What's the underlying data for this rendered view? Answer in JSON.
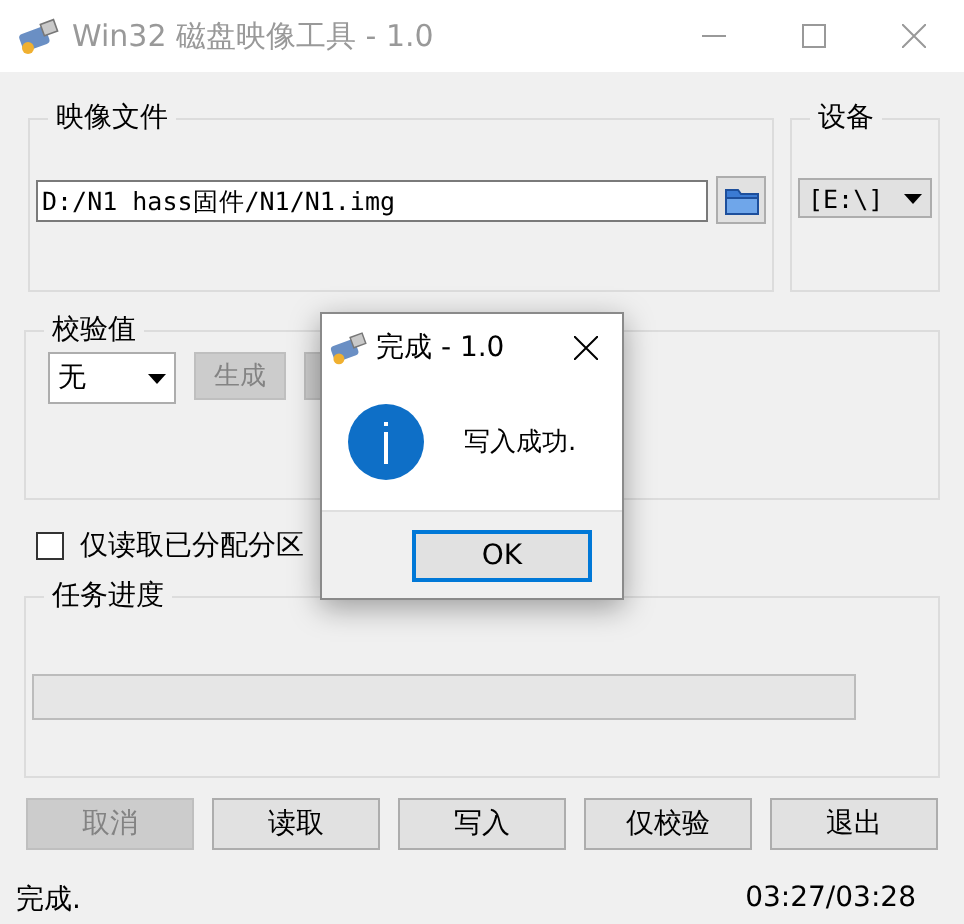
{
  "window": {
    "title": "Win32 磁盘映像工具 - 1.0"
  },
  "image_file": {
    "label": "映像文件",
    "path": "D:/N1 hass固件/N1/N1.img"
  },
  "device": {
    "label": "设备",
    "value": "[E:\\]"
  },
  "hash": {
    "label": "校验值",
    "type_value": "无",
    "buttons": [
      {
        "label": "生成",
        "disabled": true
      },
      {
        "disabled": true
      }
    ]
  },
  "read_only_allocated": {
    "label": "仅读取已分配分区",
    "checked": false
  },
  "progress": {
    "label": "任务进度",
    "level": 0
  },
  "buttons": [
    {
      "label": "取消",
      "disabled": true
    },
    {
      "label": "读取",
      "disabled": false
    },
    {
      "label": "写入",
      "disabled": false
    },
    {
      "label": "仅校验",
      "disabled": false
    },
    {
      "label": "退出",
      "disabled": false
    }
  ],
  "status_bar": {
    "message": "完成.",
    "time": "03:27/03:28"
  },
  "dialog": {
    "title": "完成 - 1.0",
    "message": "写入成功.",
    "buttons": [
      {
        "label": "OK",
        "selected": true
      }
    ]
  }
}
